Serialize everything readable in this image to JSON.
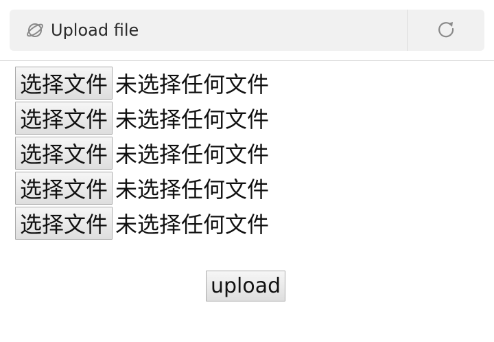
{
  "browser": {
    "page_title": "Upload file",
    "site_icon": "planet-icon",
    "reload_icon": "reload-icon"
  },
  "form": {
    "file_inputs": [
      {
        "button_label": "选择文件",
        "status_text": "未选择任何文件"
      },
      {
        "button_label": "选择文件",
        "status_text": "未选择任何文件"
      },
      {
        "button_label": "选择文件",
        "status_text": "未选择任何文件"
      },
      {
        "button_label": "选择文件",
        "status_text": "未选择任何文件"
      },
      {
        "button_label": "选择文件",
        "status_text": "未选择任何文件"
      }
    ],
    "submit_label": "upload"
  },
  "colors": {
    "toolbar_bg": "#f1f1f1",
    "icon": "#8a8a8a",
    "text": "#111111"
  }
}
